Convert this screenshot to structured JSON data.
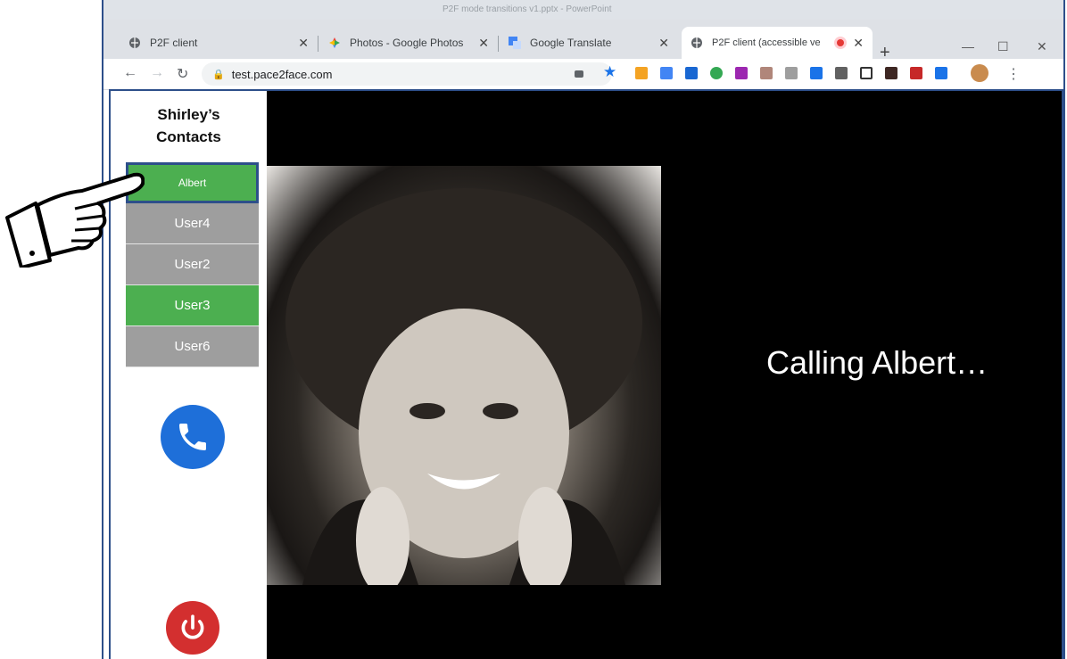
{
  "browser": {
    "title_text": "P2F mode transitions v1.pptx - PowerPoint",
    "tabs": [
      {
        "label": "P2F client",
        "icon": "globe-icon"
      },
      {
        "label": "Photos - Google Photos",
        "icon": "photos-icon"
      },
      {
        "label": "Google Translate",
        "icon": "translate-icon"
      },
      {
        "label": "P2F client (accessible ve",
        "icon": "globe-icon",
        "active": true
      }
    ],
    "new_tab": "+",
    "url": "test.pace2face.com"
  },
  "sidebar": {
    "title_line1": "Shirley’s",
    "title_line2": "Contacts",
    "contacts": [
      {
        "name": "Albert",
        "status": "online",
        "selected": true
      },
      {
        "name": "User4",
        "status": "offline"
      },
      {
        "name": "User2",
        "status": "offline"
      },
      {
        "name": "User3",
        "status": "online"
      },
      {
        "name": "User6",
        "status": "offline"
      }
    ]
  },
  "main": {
    "status_text": "Calling Albert…"
  },
  "colors": {
    "online": "#4caf50",
    "offline": "#9e9e9e",
    "call": "#1e6fd9",
    "power": "#d32f2f",
    "highlight": "#2d4f8a"
  }
}
